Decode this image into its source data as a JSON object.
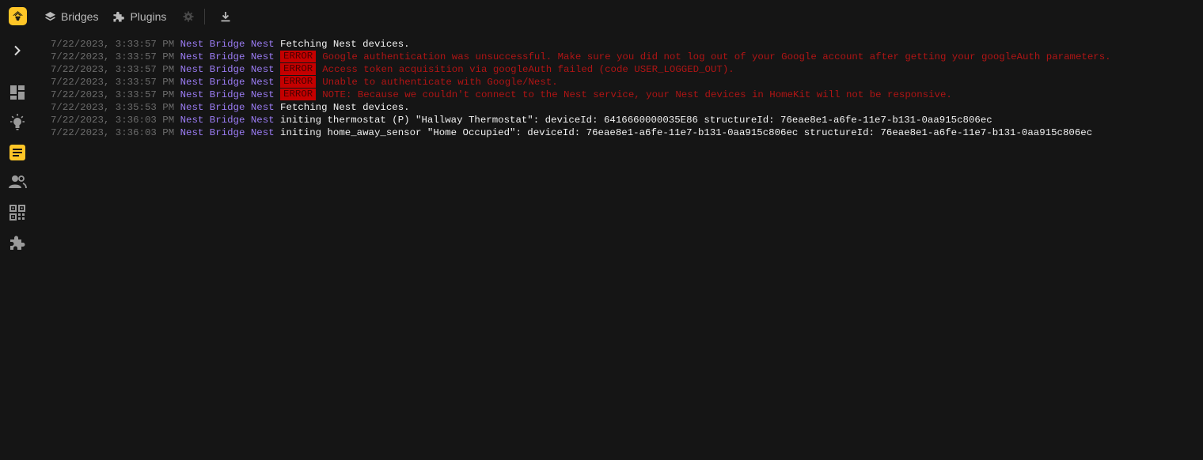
{
  "app": {
    "accent": "#ffc627",
    "logo_icon": "homebridge-logo-icon"
  },
  "sidebar": {
    "items": [
      {
        "name": "expand",
        "icon": "chevron-right-icon"
      },
      {
        "name": "status",
        "icon": "dashboard-icon"
      },
      {
        "name": "accessories",
        "icon": "lightbulb-icon"
      },
      {
        "name": "logs",
        "icon": "log-icon",
        "active": true
      },
      {
        "name": "users",
        "icon": "users-icon"
      },
      {
        "name": "qr",
        "icon": "qr-code-icon"
      },
      {
        "name": "plugins",
        "icon": "puzzle-icon"
      }
    ]
  },
  "toolbar": {
    "bridges_label": "Bridges",
    "plugins_label": "Plugins",
    "settings_icon": "gear-icon",
    "download_icon": "download-icon"
  },
  "log": {
    "colors": {
      "timestamp": "#6b6b6b",
      "source": "#9b7cf4",
      "message": "#f2f2f2",
      "error": "#b01515",
      "badge": "#c40000"
    },
    "lines": [
      {
        "ts": "7/22/2023, 3:33:57 PM",
        "src": "Nest Bridge Nest",
        "error": false,
        "badge": "",
        "msg": "Fetching Nest devices."
      },
      {
        "ts": "7/22/2023, 3:33:57 PM",
        "src": "Nest Bridge Nest",
        "error": true,
        "badge": "ERROR",
        "msg": "Google authentication was unsuccessful. Make sure you did not log out of your Google account after getting your googleAuth parameters."
      },
      {
        "ts": "7/22/2023, 3:33:57 PM",
        "src": "Nest Bridge Nest",
        "error": true,
        "badge": "ERROR",
        "msg": "Access token acquisition via googleAuth failed (code USER_LOGGED_OUT)."
      },
      {
        "ts": "7/22/2023, 3:33:57 PM",
        "src": "Nest Bridge Nest",
        "error": true,
        "badge": "ERROR",
        "msg": "Unable to authenticate with Google/Nest."
      },
      {
        "ts": "7/22/2023, 3:33:57 PM",
        "src": "Nest Bridge Nest",
        "error": true,
        "badge": "ERROR",
        "msg": "NOTE: Because we couldn't connect to the Nest service, your Nest devices in HomeKit will not be responsive."
      },
      {
        "ts": "7/22/2023, 3:35:53 PM",
        "src": "Nest Bridge Nest",
        "error": false,
        "badge": "",
        "msg": "Fetching Nest devices."
      },
      {
        "ts": "7/22/2023, 3:36:03 PM",
        "src": "Nest Bridge Nest",
        "error": false,
        "badge": "",
        "msg": "initing thermostat (P) \"Hallway Thermostat\": deviceId: 6416660000035E86 structureId: 76eae8e1-a6fe-11e7-b131-0aa915c806ec"
      },
      {
        "ts": "7/22/2023, 3:36:03 PM",
        "src": "Nest Bridge Nest",
        "error": false,
        "badge": "",
        "msg": "initing home_away_sensor \"Home Occupied\": deviceId: 76eae8e1-a6fe-11e7-b131-0aa915c806ec structureId: 76eae8e1-a6fe-11e7-b131-0aa915c806ec"
      }
    ]
  }
}
